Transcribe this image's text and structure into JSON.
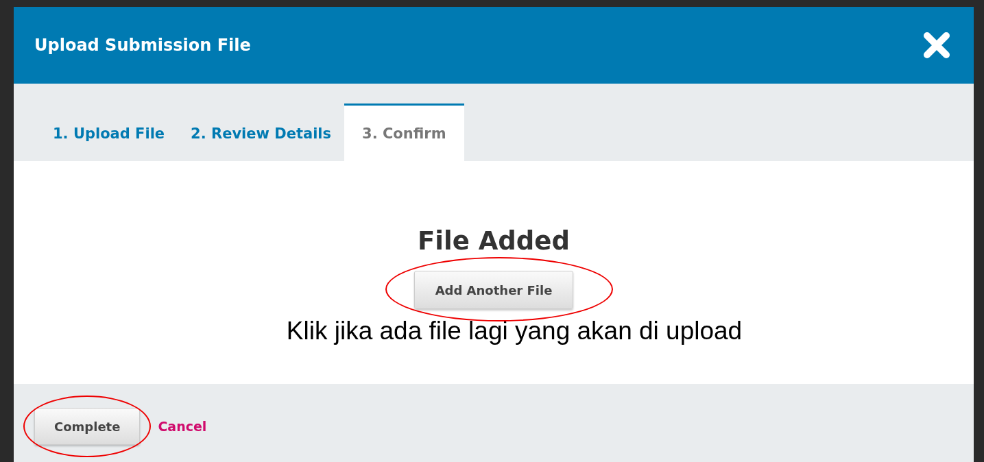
{
  "modal": {
    "title": "Upload Submission File"
  },
  "tabs": [
    {
      "label": "1. Upload File",
      "selected": false
    },
    {
      "label": "2. Review Details",
      "selected": false
    },
    {
      "label": "3. Confirm",
      "selected": true
    }
  ],
  "body": {
    "heading": "File Added",
    "add_button": "Add Another File",
    "annotation": "Klik jika ada file lagi yang akan di upload"
  },
  "footer": {
    "complete_button": "Complete",
    "cancel_link": "Cancel"
  }
}
